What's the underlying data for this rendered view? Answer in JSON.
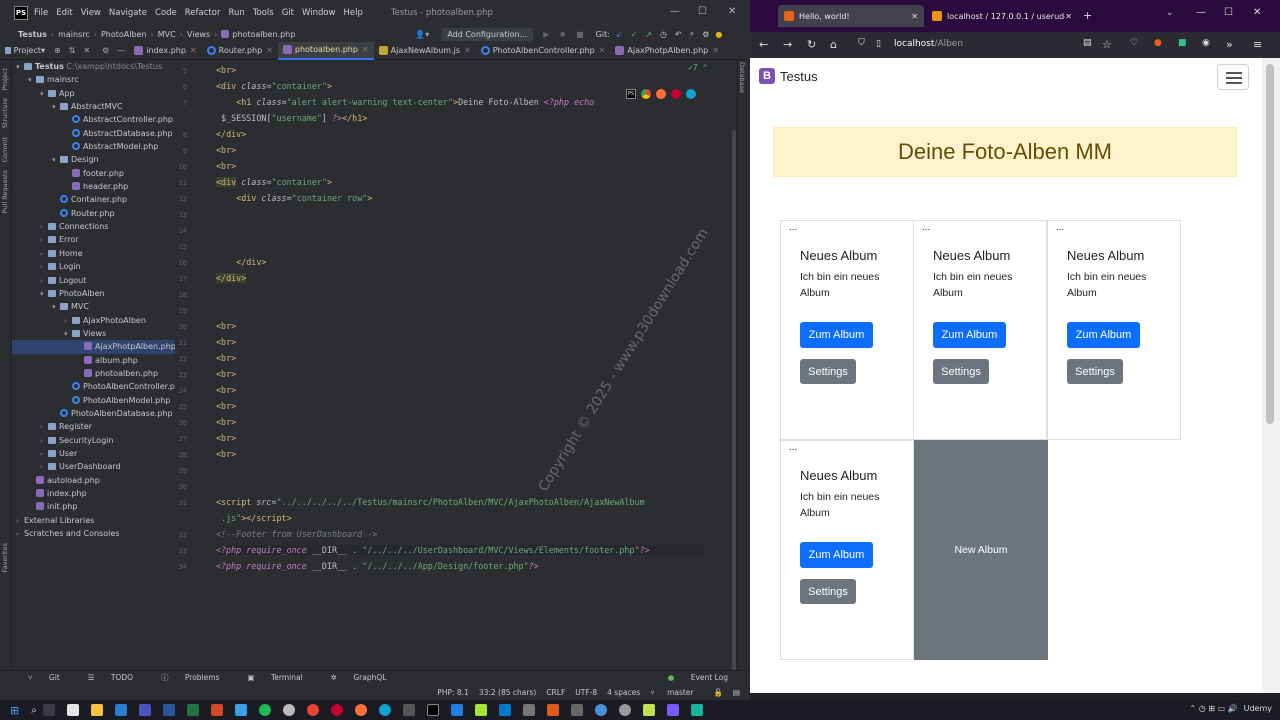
{
  "ide": {
    "menu": [
      "File",
      "Edit",
      "View",
      "Navigate",
      "Code",
      "Refactor",
      "Run",
      "Tools",
      "Git",
      "Window",
      "Help"
    ],
    "window_title": "Testus - photoalben.php",
    "breadcrumb": [
      "Testus",
      "mainsrc",
      "PhotoAlben",
      "MVC",
      "Views",
      "photoalben.php"
    ],
    "add_config": "Add Configuration...",
    "git_label": "Git:",
    "project_label": "Project",
    "tabs": [
      {
        "label": "index.php",
        "icon": "php-icon"
      },
      {
        "label": "Router.php",
        "icon": "class-icon"
      },
      {
        "label": "photoalben.php",
        "icon": "php-icon",
        "active": true
      },
      {
        "label": "AjaxNewAlbum.js",
        "icon": "js-icon"
      },
      {
        "label": "PhotoAlbenController.php",
        "icon": "class-icon"
      },
      {
        "label": "AjaxPhotpAlben.php",
        "icon": "php-icon"
      }
    ],
    "left_strip": [
      "Project",
      "Structure",
      "Commit",
      "Pull Requests",
      "Favorites"
    ],
    "right_strip": [
      "Database"
    ],
    "tree": [
      {
        "label": "Testus",
        "path": "C:\\xampp\\htdocs\\Testus",
        "depth": 0,
        "type": "root"
      },
      {
        "label": "mainsrc",
        "depth": 1,
        "type": "folder",
        "open": true
      },
      {
        "label": "App",
        "depth": 2,
        "type": "folder",
        "open": true
      },
      {
        "label": "AbstractMVC",
        "depth": 3,
        "type": "folder",
        "open": true
      },
      {
        "label": "AbstractController.php",
        "depth": 4,
        "type": "class"
      },
      {
        "label": "AbstractDatabase.php",
        "depth": 4,
        "type": "class"
      },
      {
        "label": "AbstractModel.php",
        "depth": 4,
        "type": "class"
      },
      {
        "label": "Design",
        "depth": 3,
        "type": "folder",
        "open": true
      },
      {
        "label": "footer.php",
        "depth": 4,
        "type": "php"
      },
      {
        "label": "header.php",
        "depth": 4,
        "type": "php"
      },
      {
        "label": "Container.php",
        "depth": 3,
        "type": "class"
      },
      {
        "label": "Router.php",
        "depth": 3,
        "type": "class"
      },
      {
        "label": "Connections",
        "depth": 2,
        "type": "folder"
      },
      {
        "label": "Error",
        "depth": 2,
        "type": "folder"
      },
      {
        "label": "Home",
        "depth": 2,
        "type": "folder"
      },
      {
        "label": "Login",
        "depth": 2,
        "type": "folder"
      },
      {
        "label": "Logout",
        "depth": 2,
        "type": "folder"
      },
      {
        "label": "PhotoAlben",
        "depth": 2,
        "type": "folder",
        "open": true
      },
      {
        "label": "MVC",
        "depth": 3,
        "type": "folder",
        "open": true
      },
      {
        "label": "AjaxPhotoAlben",
        "depth": 4,
        "type": "folder"
      },
      {
        "label": "Views",
        "depth": 4,
        "type": "folder",
        "open": true
      },
      {
        "label": "AjaxPhotpAlben.php",
        "depth": 5,
        "type": "php",
        "selected": true
      },
      {
        "label": "album.php",
        "depth": 5,
        "type": "php"
      },
      {
        "label": "photoalben.php",
        "depth": 5,
        "type": "php"
      },
      {
        "label": "PhotoAlbenController.php",
        "depth": 4,
        "type": "class"
      },
      {
        "label": "PhotoAlbenModel.php",
        "depth": 4,
        "type": "class"
      },
      {
        "label": "PhotoAlbenDatabase.php",
        "depth": 3,
        "type": "class"
      },
      {
        "label": "Register",
        "depth": 2,
        "type": "folder"
      },
      {
        "label": "SecurityLogin",
        "depth": 2,
        "type": "folder"
      },
      {
        "label": "User",
        "depth": 2,
        "type": "folder"
      },
      {
        "label": "UserDashboard",
        "depth": 2,
        "type": "folder"
      },
      {
        "label": "autoload.php",
        "depth": 1,
        "type": "php"
      },
      {
        "label": "index.php",
        "depth": 1,
        "type": "php"
      },
      {
        "label": "init.php",
        "depth": 1,
        "type": "php"
      },
      {
        "label": "External Libraries",
        "depth": 0,
        "type": "lib"
      },
      {
        "label": "Scratches and Consoles",
        "depth": 0,
        "type": "lib"
      }
    ],
    "line_numbers": [
      "5",
      "6",
      "7",
      "",
      "8",
      "9",
      "10",
      "11",
      "12",
      "13",
      "14",
      "15",
      "16",
      "17",
      "18",
      "19",
      "20",
      "21",
      "22",
      "23",
      "24",
      "25",
      "26",
      "27",
      "28",
      "29",
      "30",
      "31",
      "",
      "32",
      "33",
      "34"
    ],
    "problems_indicator": "7",
    "bottom_tabs": [
      "Git",
      "TODO",
      "Problems",
      "Terminal",
      "GraphQL"
    ],
    "event_log": "Event Log",
    "status": [
      "PHP: 8.1",
      "33:2 (85 chars)",
      "CRLF",
      "UTF-8",
      "4 spaces",
      "master"
    ],
    "watermark": "Copyright © 2025 - www.p30download.com"
  },
  "browser": {
    "tabs": [
      {
        "label": "Hello, world!",
        "active": true
      },
      {
        "label": "localhost / 127.0.0.1 / userude"
      }
    ],
    "url_host": "localhost",
    "url_path": "/Alben",
    "brand": "Testus",
    "brand_letter": "B",
    "heading": "Deine Foto-Alben MM",
    "cards": [
      {
        "dots": "...",
        "title": "Neues Album",
        "text": "Ich bin ein neues Album",
        "primary": "Zum Album",
        "secondary": "Settings"
      },
      {
        "dots": "...",
        "title": "Neues Album",
        "text": "Ich bin ein neues Album",
        "primary": "Zum Album",
        "secondary": "Settings"
      },
      {
        "dots": "...",
        "title": "Neues Album",
        "text": "Ich bin ein neues Album",
        "primary": "Zum Album",
        "secondary": "Settings"
      },
      {
        "dots": "...",
        "title": "Neues Album",
        "text": "Ich bin ein neues Album",
        "primary": "Zum Album",
        "secondary": "Settings"
      }
    ],
    "new_album": "New Album"
  },
  "taskbar": {
    "udemy": "Udemy"
  },
  "colors": {
    "accent": "#3574f0",
    "primary": "#0d6efd",
    "secondary": "#6c757d",
    "alert_bg": "#fff3cd",
    "alert_text": "#664d03",
    "browser_tabbar": "#2b0a3d"
  }
}
